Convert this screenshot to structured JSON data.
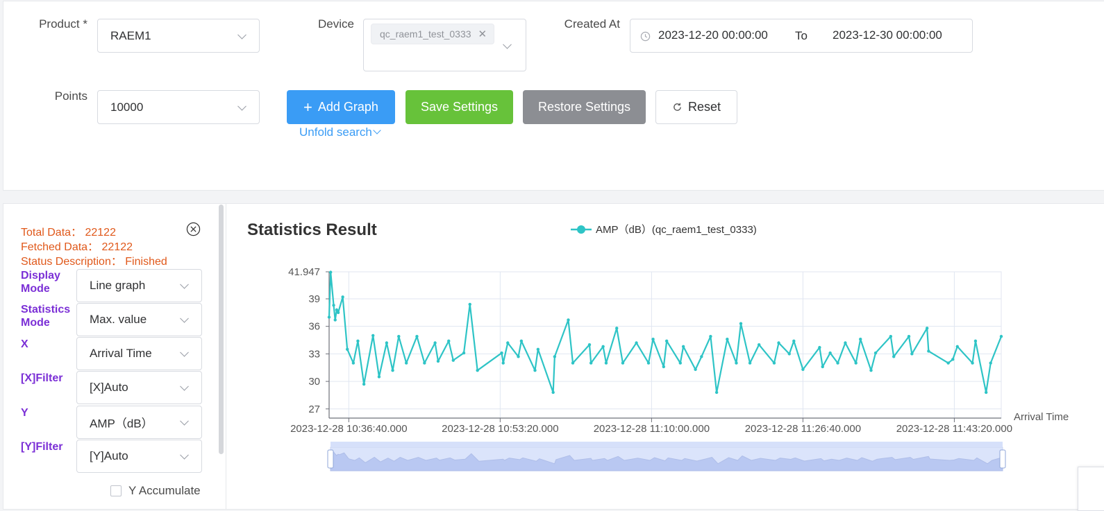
{
  "filters": {
    "product_label": "Product *",
    "product_value": "RAEM1",
    "device_label": "Device",
    "device_tag": "qc_raem1_test_0333",
    "created_label": "Created At",
    "date_start": "2023-12-20 00:00:00",
    "date_sep": "To",
    "date_end": "2023-12-30 00:00:00",
    "points_label": "Points",
    "points_value": "10000"
  },
  "actions": {
    "add_graph": "Add Graph",
    "save_settings": "Save Settings",
    "restore_settings": "Restore Settings",
    "reset": "Reset",
    "unfold": "Unfold search"
  },
  "colors": {
    "primary": "#3a9cf5",
    "success": "#67c23a",
    "info": "#8c8e93",
    "series": "#2ec4c6",
    "status": "#e0581a",
    "field_label": "#7b2fd6"
  },
  "side": {
    "total": "Total Data： 22122",
    "fetched": "Fetched Data： 22122",
    "status": "Status Description： Finished",
    "display_mode_label": "Display Mode",
    "display_mode_value": "Line graph",
    "stat_mode_label": "Statistics Mode",
    "stat_mode_value": "Max. value",
    "x_label": "X",
    "x_value": "Arrival Time",
    "xfilter_label": "[X]Filter",
    "xfilter_value": "[X]Auto",
    "y_label": "Y",
    "y_value": "AMP（dB）",
    "yfilter_label": "[Y]Filter",
    "yfilter_value": "[Y]Auto",
    "y_accumulate": "Y Accumulate"
  },
  "chart_title": "Statistics Result",
  "chart_data": {
    "type": "line",
    "legend": "AMP（dB）(qc_raem1_test_0333)",
    "legend_position": "top-center",
    "xlabel": "Arrival Time",
    "ylabel": "",
    "grid": true,
    "ylim": [
      26,
      41.947
    ],
    "yticks": [
      27,
      30,
      33,
      36,
      39,
      41.947
    ],
    "ytick_labels": [
      "27",
      "30",
      "33",
      "36",
      "39",
      "41.947"
    ],
    "xlim": [
      "2023-12-28 10:34:30",
      "2023-12-28 11:48:30"
    ],
    "xticks": [
      "2023-12-28 10:36:40",
      "2023-12-28 10:53:20",
      "2023-12-28 11:10:00",
      "2023-12-28 11:26:40",
      "2023-12-28 11:43:20"
    ],
    "xtick_labels": [
      "2023-12-28 10:36:40.000",
      "2023-12-28 10:53:20.000",
      "2023-12-28 11:10:00.000",
      "2023-12-28 11:26:40.000",
      "2023-12-28 11:43:20.000"
    ],
    "series": [
      {
        "x": [
          "2023-12-28 10:34:30",
          "2023-12-28 10:34:40",
          "2023-12-28 10:35:00",
          "2023-12-28 10:35:10",
          "2023-12-28 10:35:20",
          "2023-12-28 10:35:30",
          "2023-12-28 10:36:00",
          "2023-12-28 10:36:30",
          "2023-12-28 10:37:10",
          "2023-12-28 10:37:40",
          "2023-12-28 10:38:20",
          "2023-12-28 10:39:20",
          "2023-12-28 10:40:00",
          "2023-12-28 10:40:50",
          "2023-12-28 10:41:30",
          "2023-12-28 10:42:10",
          "2023-12-28 10:43:00",
          "2023-12-28 10:44:10",
          "2023-12-28 10:45:00",
          "2023-12-28 10:46:10",
          "2023-12-28 10:46:30",
          "2023-12-28 10:47:40",
          "2023-12-28 10:48:10",
          "2023-12-28 10:49:20",
          "2023-12-28 10:50:00",
          "2023-12-28 10:50:50",
          "2023-12-28 10:53:30",
          "2023-12-28 10:53:40",
          "2023-12-28 10:54:10",
          "2023-12-28 10:55:20",
          "2023-12-28 10:55:40",
          "2023-12-28 10:57:10",
          "2023-12-28 10:57:30",
          "2023-12-28 10:59:10",
          "2023-12-28 10:59:20",
          "2023-12-28 11:00:50",
          "2023-12-28 11:01:20",
          "2023-12-28 11:03:10",
          "2023-12-28 11:03:20",
          "2023-12-28 11:04:40",
          "2023-12-28 11:05:00",
          "2023-12-28 11:06:10",
          "2023-12-28 11:06:50",
          "2023-12-28 11:08:20",
          "2023-12-28 11:09:40",
          "2023-12-28 11:10:10",
          "2023-12-28 11:11:20",
          "2023-12-28 11:11:40",
          "2023-12-28 11:13:10",
          "2023-12-28 11:13:30",
          "2023-12-28 11:14:50",
          "2023-12-28 11:15:30",
          "2023-12-28 11:16:30",
          "2023-12-28 11:17:10",
          "2023-12-28 11:18:20",
          "2023-12-28 11:19:20",
          "2023-12-28 11:19:50",
          "2023-12-28 11:20:50",
          "2023-12-28 11:21:50",
          "2023-12-28 11:23:30",
          "2023-12-28 11:24:00",
          "2023-12-28 11:25:10",
          "2023-12-28 11:25:40",
          "2023-12-28 11:26:40",
          "2023-12-28 11:28:30",
          "2023-12-28 11:28:50",
          "2023-12-28 11:29:40",
          "2023-12-28 11:30:30",
          "2023-12-28 11:31:20",
          "2023-12-28 11:32:30",
          "2023-12-28 11:33:00",
          "2023-12-28 11:34:10",
          "2023-12-28 11:34:40",
          "2023-12-28 11:36:20",
          "2023-12-28 11:36:40",
          "2023-12-28 11:38:20",
          "2023-12-28 11:38:40",
          "2023-12-28 11:40:20",
          "2023-12-28 11:40:30",
          "2023-12-28 11:42:40",
          "2023-12-28 11:43:10",
          "2023-12-28 11:43:40",
          "2023-12-28 11:45:20",
          "2023-12-28 11:45:40",
          "2023-12-28 11:46:50",
          "2023-12-28 11:47:20",
          "2023-12-28 11:48:30"
        ],
        "y": [
          37.0,
          41.9,
          38.3,
          36.7,
          37.8,
          37.5,
          39.2,
          33.5,
          32.0,
          34.4,
          29.7,
          35.0,
          30.5,
          34.2,
          31.2,
          34.9,
          32.0,
          34.9,
          32.0,
          34.2,
          32.2,
          34.4,
          32.3,
          33.1,
          38.4,
          31.2,
          33.1,
          32.0,
          34.2,
          32.7,
          34.4,
          31.2,
          33.5,
          28.8,
          32.7,
          36.7,
          32.0,
          34.0,
          32.0,
          33.8,
          32.0,
          35.8,
          32.0,
          34.2,
          32.0,
          34.6,
          31.6,
          34.4,
          32.0,
          33.8,
          31.3,
          32.7,
          34.9,
          28.8,
          34.6,
          32.0,
          36.3,
          32.0,
          34.0,
          32.0,
          34.2,
          33.0,
          34.4,
          31.3,
          33.7,
          31.6,
          33.1,
          32.0,
          34.2,
          32.0,
          34.6,
          31.2,
          33.1,
          34.9,
          32.7,
          34.9,
          33.0,
          35.8,
          33.3,
          32.0,
          32.4,
          33.8,
          32.0,
          34.4,
          28.8,
          32.0,
          34.9
        ]
      }
    ]
  }
}
